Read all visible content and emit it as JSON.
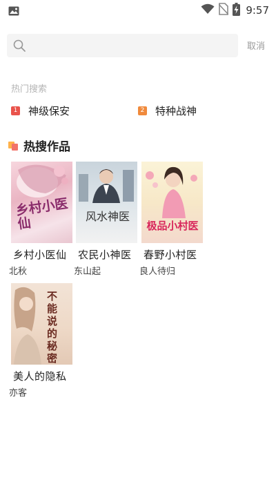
{
  "status_bar": {
    "time": "9:57"
  },
  "search": {
    "placeholder": "",
    "value": "",
    "cancel_label": "取消"
  },
  "hot_search": {
    "title": "热门搜索",
    "items": [
      {
        "rank": "1",
        "label": "神级保安",
        "color": "#e9534b"
      },
      {
        "rank": "2",
        "label": "特种战神",
        "color": "#f08a3c"
      }
    ]
  },
  "hot_works": {
    "title": "热搜作品",
    "books": [
      {
        "title": "乡村小医仙",
        "author": "北秋",
        "cover_text": "乡村小医仙"
      },
      {
        "title": "农民小神医",
        "author": "东山起",
        "cover_text": "风水神医"
      },
      {
        "title": "春野小村医",
        "author": "良人待归",
        "cover_text": "极品小村医"
      },
      {
        "title": "美人的隐私",
        "author": "亦客",
        "cover_text": "不能说的秘密"
      }
    ]
  }
}
